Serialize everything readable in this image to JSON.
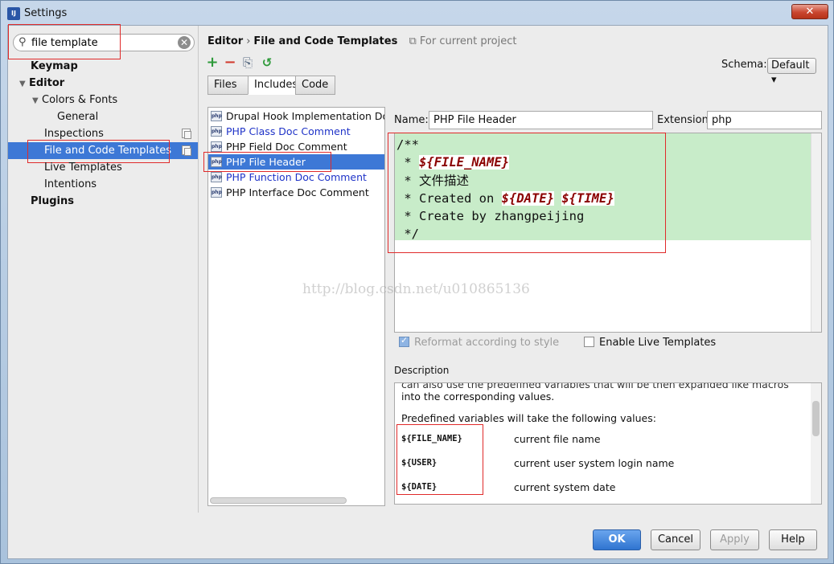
{
  "window": {
    "title": "Settings",
    "close_glyph": "✕",
    "app_icon": "IJ"
  },
  "search": {
    "value": "file template",
    "search_glyph": "⚲",
    "clear_glyph": "✕"
  },
  "tree": {
    "keymap": "Keymap",
    "editor": "Editor",
    "colors_fonts": "Colors & Fonts",
    "general": "General",
    "inspections": "Inspections",
    "file_code_templates": "File and Code Templates",
    "live_templates": "Live Templates",
    "intentions": "Intentions",
    "plugins": "Plugins"
  },
  "breadcrumb": {
    "part1": "Editor",
    "sep": "›",
    "part2": "File and Code Templates",
    "project_note": "For current project"
  },
  "toolbar": {
    "add": "+",
    "remove": "−",
    "copy": "⎘",
    "reset": "↺"
  },
  "schema": {
    "label": "Schema:",
    "value": "Default ▾"
  },
  "tabs": [
    "Files",
    "Includes",
    "Code"
  ],
  "templates": {
    "icon_text": "php",
    "items": [
      "Drupal Hook Implementation Doc",
      "PHP Class Doc Comment",
      "PHP Field Doc Comment",
      "PHP File Header",
      "PHP Function Doc Comment",
      "PHP Interface Doc Comment"
    ]
  },
  "name_field": {
    "label": "Name:",
    "value": "PHP File Header"
  },
  "extension_field": {
    "label": "Extension:",
    "value": "php"
  },
  "code": {
    "l1": "/**",
    "l2_prefix": " * ",
    "file_name_var": "${FILE_NAME}",
    "l3": " * 文件描述",
    "l4_prefix": " * Created on ",
    "date_var": "${DATE}",
    "time_var": "${TIME}",
    "l5": " * Create by zhangpeijing",
    "l6": " */"
  },
  "watermark": "http://blog.csdn.net/u010865136",
  "options": {
    "reformat": "Reformat according to style",
    "live_templates": "Enable Live Templates"
  },
  "description": {
    "label": "Description",
    "cut_line": "can also use the predefined variables that will be then expanded like macros",
    "line1": "into the corresponding values.",
    "line2": "Predefined variables will take the following values:",
    "vars": [
      {
        "name": "${FILE_NAME}",
        "desc": "current file name"
      },
      {
        "name": "${USER}",
        "desc": "current user system login name"
      },
      {
        "name": "${DATE}",
        "desc": "current system date"
      }
    ]
  },
  "buttons": {
    "ok": "OK",
    "cancel": "Cancel",
    "apply": "Apply",
    "help": "Help"
  }
}
